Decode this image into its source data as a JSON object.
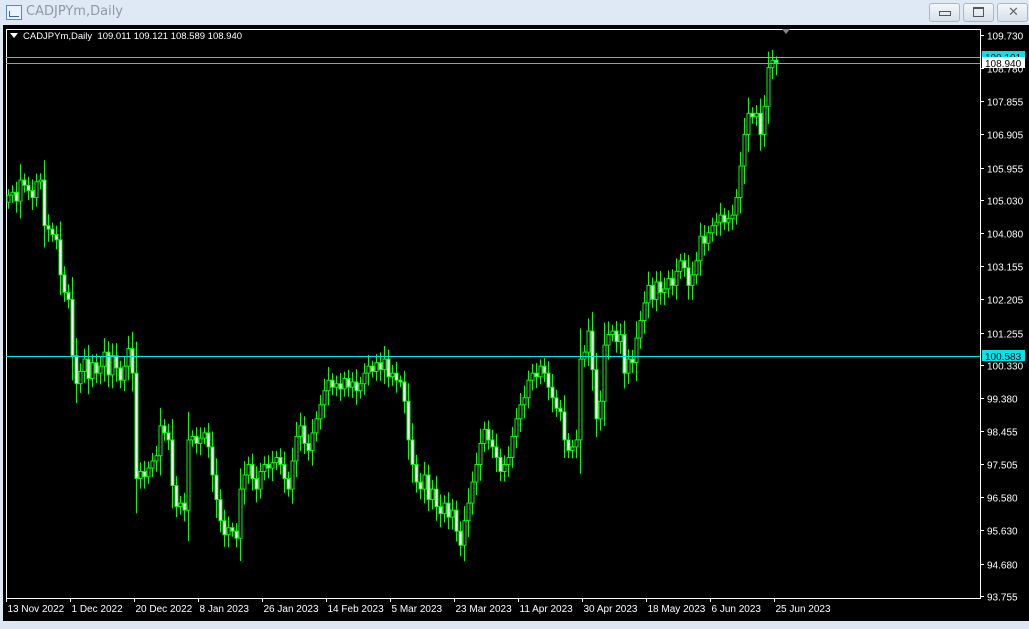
{
  "window": {
    "title": "CADJPYm,Daily",
    "buttons": [
      "minimize",
      "maximize",
      "close"
    ]
  },
  "legend": {
    "symbol": "CADJPYm,Daily",
    "ohlc": "109.011 109.121 108.589 108.940"
  },
  "colors": {
    "background": "#000000",
    "candle": "#00ff00",
    "bull_body": "#000000",
    "bear_body": "#ffffff",
    "hline": "#00e5ee",
    "bid_line": "#9a9a9a",
    "axis_text": "#ffffff"
  },
  "chart_data": {
    "type": "candlestick",
    "symbol": "CADJPYm",
    "timeframe": "Daily",
    "ylim": [
      93.755,
      109.73
    ],
    "y_ticks": [
      "109.730",
      "108.780",
      "107.855",
      "106.905",
      "105.955",
      "105.030",
      "104.080",
      "103.155",
      "102.205",
      "101.255",
      "100.330",
      "99.380",
      "98.455",
      "97.505",
      "96.580",
      "95.630",
      "94.680",
      "93.755"
    ],
    "x_ticks": [
      "13 Nov 2022",
      "1 Dec 2022",
      "20 Dec 2022",
      "8 Jan 2023",
      "26 Jan 2023",
      "14 Feb 2023",
      "5 Mar 2023",
      "23 Mar 2023",
      "11 Apr 2023",
      "30 Apr 2023",
      "18 May 2023",
      "6 Jun 2023",
      "25 Jun 2023"
    ],
    "bars_per_x_tick": 16,
    "close": [
      105.17,
      105.25,
      105.0,
      105.6,
      105.45,
      105.3,
      105.1,
      105.55,
      105.6,
      104.3,
      104.2,
      104.05,
      103.9,
      102.9,
      102.4,
      102.2,
      100.6,
      99.8,
      100.15,
      100.5,
      99.95,
      100.4,
      100.1,
      100.3,
      100.7,
      100.05,
      100.6,
      100.25,
      99.9,
      100.3,
      100.8,
      100.1,
      97.1,
      97.3,
      97.15,
      97.4,
      97.6,
      97.75,
      98.6,
      98.4,
      98.2,
      96.9,
      96.3,
      96.4,
      96.2,
      98.2,
      98.3,
      98.1,
      98.25,
      98.4,
      98.0,
      97.2,
      96.5,
      95.9,
      95.5,
      95.7,
      95.6,
      95.4,
      96.8,
      97.2,
      97.5,
      97.1,
      96.8,
      97.3,
      97.5,
      97.4,
      97.55,
      97.7,
      97.5,
      97.1,
      96.8,
      97.6,
      98.3,
      98.6,
      98.1,
      97.9,
      98.4,
      98.8,
      99.2,
      99.6,
      99.9,
      99.7,
      99.8,
      99.65,
      99.95,
      99.7,
      99.85,
      99.6,
      99.8,
      100.1,
      100.3,
      100.15,
      100.4,
      100.2,
      100.5,
      100.0,
      100.1,
      99.9,
      99.85,
      99.3,
      98.2,
      97.5,
      97.0,
      96.8,
      97.2,
      96.5,
      96.8,
      96.3,
      96.1,
      96.4,
      96.0,
      96.2,
      95.6,
      95.2,
      95.9,
      96.4,
      97.0,
      97.5,
      98.1,
      98.5,
      98.2,
      98.0,
      97.7,
      97.3,
      97.5,
      97.7,
      98.3,
      98.8,
      99.2,
      99.4,
      99.9,
      100.1,
      100.0,
      100.3,
      100.1,
      99.7,
      99.4,
      99.1,
      99.0,
      98.2,
      97.9,
      98.0,
      98.2,
      100.5,
      100.7,
      101.3,
      100.2,
      98.8,
      99.3,
      100.9,
      101.2,
      101.3,
      101.0,
      101.2,
      100.1,
      100.5,
      100.4,
      101.1,
      101.6,
      102.1,
      102.6,
      102.2,
      102.7,
      102.4,
      102.5,
      102.8,
      102.6,
      103.0,
      103.3,
      103.1,
      102.6,
      102.9,
      103.3,
      104.0,
      103.8,
      104.1,
      104.3,
      104.4,
      104.6,
      104.4,
      104.5,
      104.6,
      105.1,
      106.0,
      106.9,
      107.5,
      107.4,
      107.5,
      106.9,
      107.7,
      108.8,
      109.01,
      108.94
    ],
    "last_bar": {
      "open": 109.011,
      "high": 109.121,
      "low": 108.589,
      "close": 108.94
    },
    "horizontal_lines": [
      {
        "price": 100.583,
        "label": "100.583",
        "color": "#00e5ee"
      },
      {
        "price": 109.101,
        "label": "109.101",
        "color": "#00e5ee"
      },
      {
        "price": 108.94,
        "label": "108.940",
        "color": "#9a9a9a"
      }
    ],
    "grid": false
  }
}
